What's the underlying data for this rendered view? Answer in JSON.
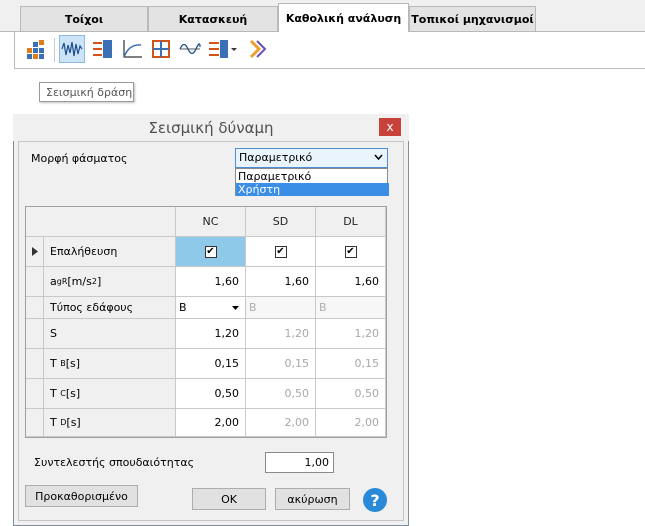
{
  "tabs": [
    "Τοίχοι",
    "Κατασκευή",
    "Καθολική ανάλυση",
    "Τοπικοί μηχανισμοί"
  ],
  "active_tab": "Καθολική ανάλυση",
  "toolbar_icons": [
    "seismic-grid-icon",
    "seismic-wave-icon",
    "wall-forces-icon",
    "curve-icon",
    "frame-icon",
    "spectrum-icon",
    "load-menu-icon",
    "arrow-next-icon"
  ],
  "tooltip": "Σεισμική δράση",
  "dialog": {
    "title": "Σεισμική δύναμη",
    "close_label": "x",
    "spectrum_label": "Μορφή φάσματος",
    "spectrum_value": "Παραμετρικό",
    "spectrum_options": [
      "Παραμετρικό",
      "Χρήστη"
    ],
    "highlighted_option": "Χρήστη",
    "columns": [
      "NC",
      "SD",
      "DL"
    ],
    "rows": {
      "check": {
        "label": "Επαλήθευση"
      },
      "agr": {
        "label_main": "a",
        "label_sub": "gR",
        "label_unit": " [m/s",
        "label_sup": "2",
        "label_end": "]",
        "values": [
          "1,60",
          "1,60",
          "1,60"
        ]
      },
      "soil": {
        "label": "Τύπος εδάφους",
        "values": [
          "B",
          "B",
          "B"
        ]
      },
      "s": {
        "label": "S",
        "values": [
          "1,20",
          "1,20",
          "1,20"
        ]
      },
      "tb": {
        "label_main": "T",
        "label_sub": "B",
        "label_unit": " [s]",
        "values": [
          "0,15",
          "0,15",
          "0,15"
        ]
      },
      "tc": {
        "label_main": "T",
        "label_sub": "C",
        "label_unit": " [s]",
        "values": [
          "0,50",
          "0,50",
          "0,50"
        ]
      },
      "td": {
        "label_main": "T",
        "label_sub": "D",
        "label_unit": " [s]",
        "values": [
          "2,00",
          "2,00",
          "2,00"
        ]
      }
    },
    "importance_label": "Συντελεστής σπουδαιότητας",
    "importance_value": "1,00",
    "default_button": "Προκαθορισμένο",
    "ok_button": "OK",
    "cancel_button": "ακύρωση",
    "help_label": "?"
  }
}
